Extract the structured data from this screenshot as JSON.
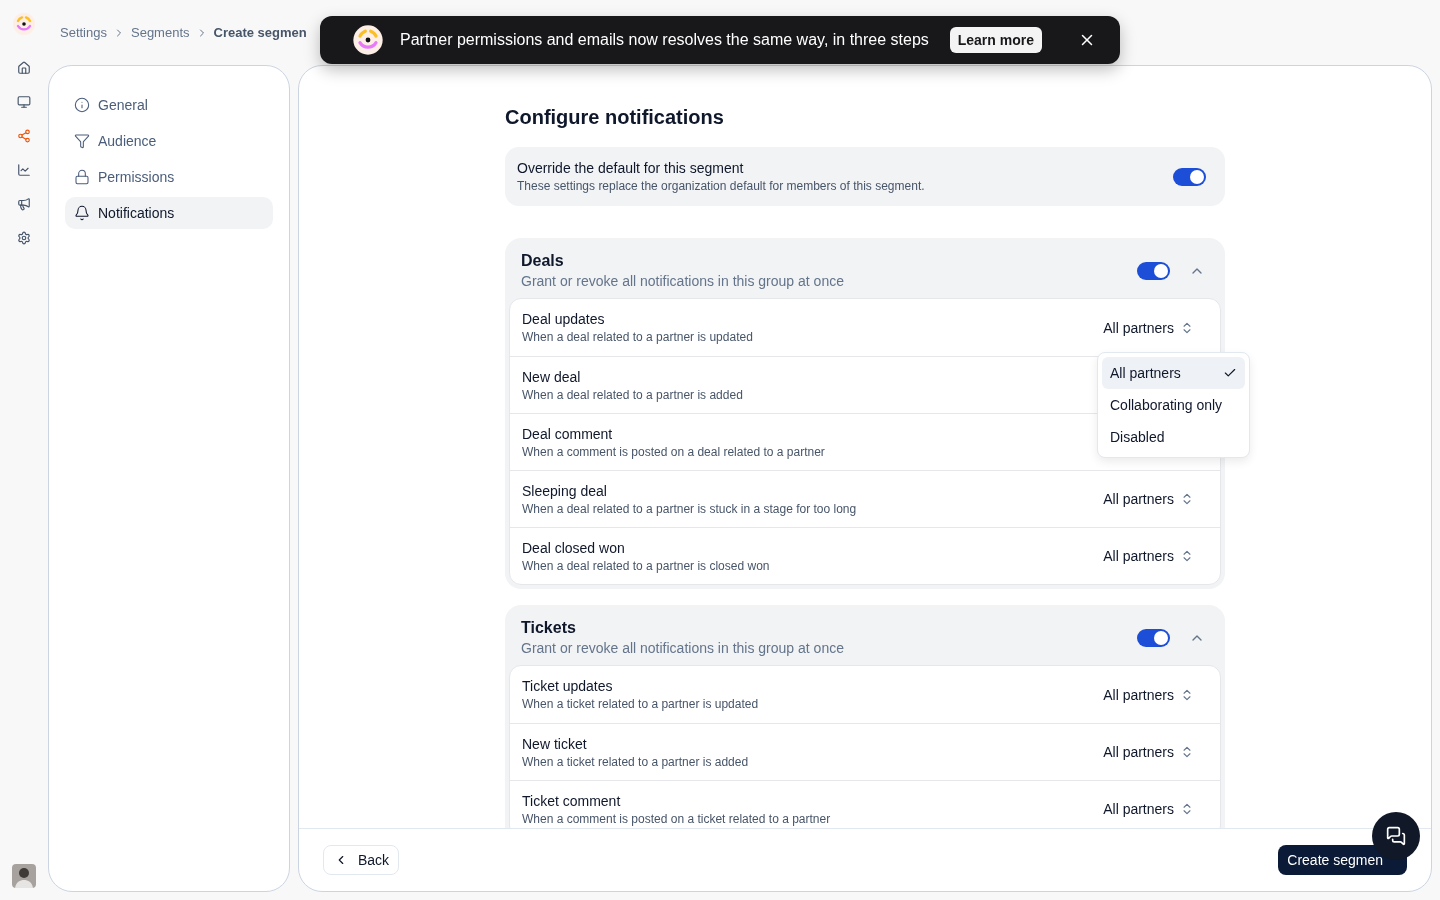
{
  "breadcrumb": [
    {
      "label": "Settings",
      "current": false
    },
    {
      "label": "Segments",
      "current": false
    },
    {
      "label": "Create segmen",
      "current": true
    }
  ],
  "banner": {
    "text": "Partner permissions and emails now resolves the same way, in three steps",
    "action": "Learn more"
  },
  "rail": [
    {
      "active": false
    },
    {
      "active": false
    },
    {
      "active": true
    },
    {
      "active": false
    },
    {
      "active": false
    },
    {
      "active": false
    }
  ],
  "nav": [
    {
      "label": "General",
      "selected": false
    },
    {
      "label": "Audience",
      "selected": false
    },
    {
      "label": "Permissions",
      "selected": false
    },
    {
      "label": "Notifications",
      "selected": true
    }
  ],
  "title": "Configure notifications",
  "override": {
    "title": "Override the default for this segment",
    "description": "These settings replace the organization default for members of this segment.",
    "on": true
  },
  "groups": [
    {
      "title": "Deals",
      "description": "Grant or revoke all notifications in this group at once",
      "on": true,
      "expanded": true,
      "rows": [
        {
          "title": "Deal updates",
          "description": "When a deal related to a partner is updated",
          "value": "All partners"
        },
        {
          "title": "New deal",
          "description": "When a deal related to a partner is added"
        },
        {
          "title": "Deal comment",
          "description": "When a comment is posted on a deal related to a partner"
        },
        {
          "title": "Sleeping deal",
          "description": "When a deal related to a partner is stuck in a stage for too long",
          "value": "All partners"
        },
        {
          "title": "Deal closed won",
          "description": "When a deal related to a partner is closed won",
          "value": "All partners"
        }
      ]
    },
    {
      "title": "Tickets",
      "description": "Grant or revoke all notifications in this group at once",
      "on": true,
      "expanded": true,
      "rows": [
        {
          "title": "Ticket updates",
          "description": "When a ticket related to a partner is updated",
          "value": "All partners"
        },
        {
          "title": "New ticket",
          "description": "When a ticket related to a partner is added",
          "value": "All partners"
        },
        {
          "title": "Ticket comment",
          "description": "When a comment is posted on a ticket related to a partner",
          "value": "All partners"
        }
      ]
    }
  ],
  "dropdown": {
    "options": [
      {
        "label": "All partners",
        "selected": true
      },
      {
        "label": "Collaborating only",
        "selected": false
      },
      {
        "label": "Disabled",
        "selected": false
      }
    ]
  },
  "footer": {
    "back": "Back",
    "create": "Create segmen"
  }
}
